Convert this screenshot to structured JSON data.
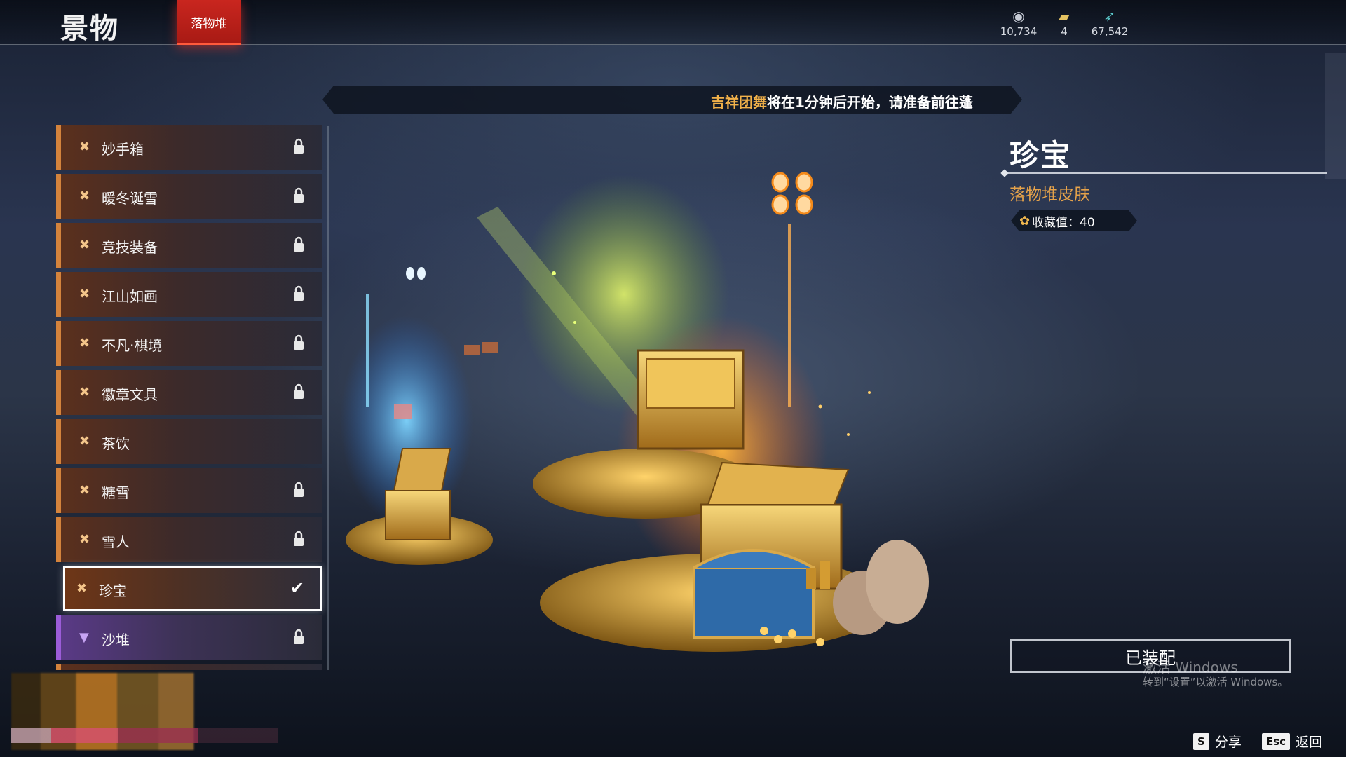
{
  "header": {
    "title": "景物",
    "active_tab": "落物堆",
    "currencies": [
      {
        "icon": "coin-eye-icon",
        "value": "10,734"
      },
      {
        "icon": "ticket-icon",
        "value": "4"
      },
      {
        "icon": "feather-icon",
        "value": "67,542"
      }
    ]
  },
  "banner": {
    "highlight": "吉祥团舞",
    "text": "将在1分钟后开始，请准备前往蓬"
  },
  "list": {
    "items": [
      {
        "label": "妙手箱",
        "state": "locked"
      },
      {
        "label": "暖冬诞雪",
        "state": "locked"
      },
      {
        "label": "竞技装备",
        "state": "locked"
      },
      {
        "label": "江山如画",
        "state": "locked"
      },
      {
        "label": "不凡·棋境",
        "state": "locked"
      },
      {
        "label": "徽章文具",
        "state": "locked"
      },
      {
        "label": "茶饮",
        "state": "unlocked"
      },
      {
        "label": "糖雪",
        "state": "locked"
      },
      {
        "label": "雪人",
        "state": "locked"
      },
      {
        "label": "珍宝",
        "state": "selected"
      },
      {
        "label": "沙堆",
        "state": "locked"
      }
    ]
  },
  "detail": {
    "title": "珍宝",
    "subtitle": "落物堆皮肤",
    "collect_label": "收藏值：40",
    "button_label": "已装配"
  },
  "watermark": {
    "line1": "激活 Windows",
    "line2": "转到“设置”以激活 Windows。"
  },
  "hints": {
    "share_key": "S",
    "share_label": "分享",
    "back_key": "Esc",
    "back_label": "返回"
  },
  "colors": {
    "accent_red": "#c9261f",
    "accent_gold": "#e5a24a",
    "item_border_orange": "#d4833c",
    "item_border_purple": "#9b5cd8"
  }
}
